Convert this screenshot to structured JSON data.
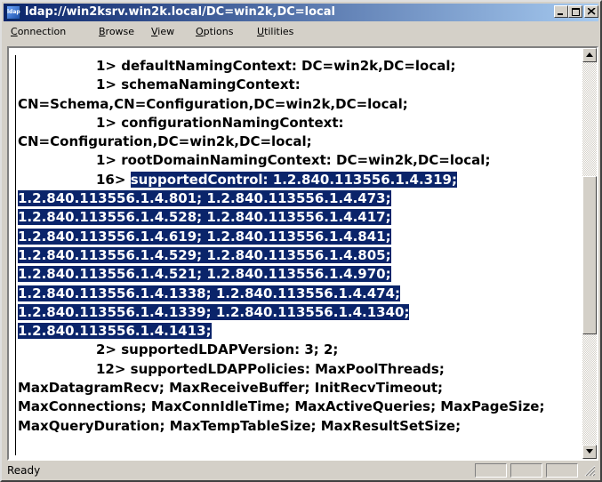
{
  "window": {
    "title": "ldap://win2ksrv.win2k.local/DC=win2k,DC=local",
    "icon": "ldap-app-icon",
    "icon_text": "ldap"
  },
  "menu": {
    "items": [
      {
        "mnemonic": "C",
        "rest": "onnection"
      },
      {
        "mnemonic": "B",
        "rest": "rowse"
      },
      {
        "mnemonic": "V",
        "rest": "iew"
      },
      {
        "mnemonic": "O",
        "rest": "ptions"
      },
      {
        "mnemonic": "U",
        "rest": "tilities"
      }
    ]
  },
  "output": {
    "lines": [
      {
        "text": "1> defaultNamingContext: DC=win2k,DC=local;"
      },
      {
        "text": "1> schemaNamingContext:"
      },
      {
        "text": "CN=Schema,CN=Configuration,DC=win2k,DC=local;"
      },
      {
        "text": "1> configurationNamingContext:"
      },
      {
        "text": "CN=Configuration,DC=win2k,DC=local;"
      },
      {
        "text": "1> rootDomainNamingContext: DC=win2k,DC=local;"
      },
      {
        "prefix": "16>",
        "text": "supportedControl: 1.2.840.113556.1.4.319;"
      },
      {
        "text": "1.2.840.113556.1.4.801; 1.2.840.113556.1.4.473;"
      },
      {
        "text": "1.2.840.113556.1.4.528; 1.2.840.113556.1.4.417;"
      },
      {
        "text": "1.2.840.113556.1.4.619; 1.2.840.113556.1.4.841;"
      },
      {
        "text": "1.2.840.113556.1.4.529; 1.2.840.113556.1.4.805;"
      },
      {
        "text": "1.2.840.113556.1.4.521; 1.2.840.113556.1.4.970;"
      },
      {
        "text": "1.2.840.113556.1.4.1338; 1.2.840.113556.1.4.474;"
      },
      {
        "text": "1.2.840.113556.1.4.1339; 1.2.840.113556.1.4.1340;"
      },
      {
        "text": "1.2.840.113556.1.4.1413;"
      },
      {
        "text": "2> supportedLDAPVersion: 3; 2;"
      },
      {
        "text": "12> supportedLDAPPolicies: MaxPoolThreads;"
      },
      {
        "text": "MaxDatagramRecv; MaxReceiveBuffer; InitRecvTimeout;"
      },
      {
        "text": "MaxConnections; MaxConnIdleTime; MaxActiveQueries; MaxPageSize;"
      },
      {
        "text": "MaxQueryDuration; MaxTempTableSize; MaxResultSetSize;"
      }
    ],
    "selection_color": "#0a246a"
  },
  "status": {
    "text": "Ready"
  },
  "colors": {
    "titlebar_start": "#0a246a",
    "titlebar_end": "#a6caf0",
    "chrome": "#d4d0c8"
  }
}
